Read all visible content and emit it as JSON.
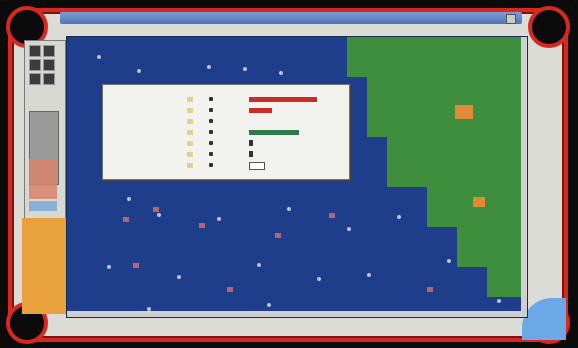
{
  "colors": {
    "frame_red": "#d8281f",
    "ocean": "#1e3d8a",
    "land": "#3f8e3d",
    "desert": "#e08a3a",
    "bar_red": "#c92b27",
    "bar_green": "#2f7a4b"
  },
  "icons": [
    "tool-icon-1",
    "tool-icon-2",
    "tool-icon-3",
    "tool-icon-4",
    "tool-icon-5",
    "tool-icon-6",
    "close-icon"
  ],
  "window": {
    "title": ""
  },
  "popup": {
    "title": "",
    "rows": [
      {
        "label": "",
        "value": "",
        "bar_color": "#c92b27",
        "bar_fraction": 0.75,
        "kind": "bar"
      },
      {
        "label": "",
        "value": "",
        "bar_color": "#c92b27",
        "bar_fraction": 0.25,
        "kind": "bar"
      },
      {
        "label": "",
        "value": "",
        "bar_color": "#c92b27",
        "bar_fraction": 0.0,
        "kind": "none"
      },
      {
        "label": "",
        "value": "",
        "bar_color": "#2f7a4b",
        "bar_fraction": 0.55,
        "kind": "bar"
      },
      {
        "label": "",
        "value": "",
        "bar_color": "#333333",
        "bar_fraction": 0.0,
        "kind": "swatch"
      },
      {
        "label": "",
        "value": "",
        "bar_color": "#333333",
        "bar_fraction": 0.0,
        "kind": "swatch"
      },
      {
        "label": "",
        "value": "",
        "bar_color": "#ffffff",
        "bar_fraction": 0.0,
        "kind": "box"
      }
    ]
  }
}
